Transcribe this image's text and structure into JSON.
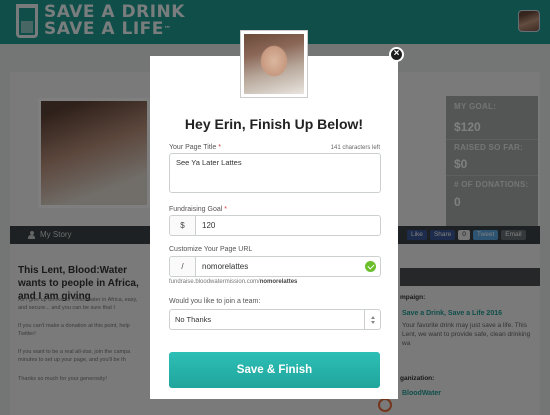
{
  "header": {
    "logo_line1": "SAVE A DRINK",
    "logo_line2": "SAVE A LIFE",
    "trademark": "™",
    "brand_color": "#1f9d93"
  },
  "stats": {
    "goal_label": "MY GOAL:",
    "goal_value": "$120",
    "raised_label": "RAISED SO FAR:",
    "raised_value": "$0",
    "donations_label": "# OF DONATIONS:",
    "donations_value": "0"
  },
  "tabs": {
    "my_story": "My Story",
    "like": "Like",
    "share": "Share",
    "share_count": "0",
    "tweet": "Tweet",
    "email": "Email"
  },
  "story": {
    "title": "This Lent, Blood:Water wants to people in Africa, and I am giving",
    "p1": "As I give up drinks for clean water in Africa, easy, and secure... and you can be sure that I",
    "p2": "If you can't make a donation at this point, help Twitter!",
    "p3": "If you want to be a real all-star, join the campa minutes to set up your page, and you'll be th",
    "p4": "Thanks so much for your generosity!"
  },
  "right_column": {
    "campaign_label": "mpaign:",
    "campaign_link": "Save a Drink, Save a Life 2016",
    "campaign_text": "Your favorite drink may just save a life. This Lent, we want to provide safe, clean drinking wa",
    "organization_label": "ganization:",
    "organization_link": "BloodWater"
  },
  "modal": {
    "heading": "Hey Erin, Finish Up Below!",
    "page_title_label": "Your Page Title",
    "required_mark": "*",
    "char_count": "141 characters left",
    "page_title_value": "See Ya Later Lattes",
    "goal_label": "Fundraising Goal",
    "goal_currency": "$",
    "goal_value": "120",
    "url_label": "Customize Your Page URL",
    "url_prefix": "/",
    "url_value": "nomorelattes",
    "url_hint_base": "fundraise.bloodwatermission.com/",
    "url_hint_slug": "nomorelattes",
    "team_label": "Would you like to join a team:",
    "team_value": "No Thanks",
    "submit_label": "Save & Finish",
    "close_glyph": "×"
  }
}
